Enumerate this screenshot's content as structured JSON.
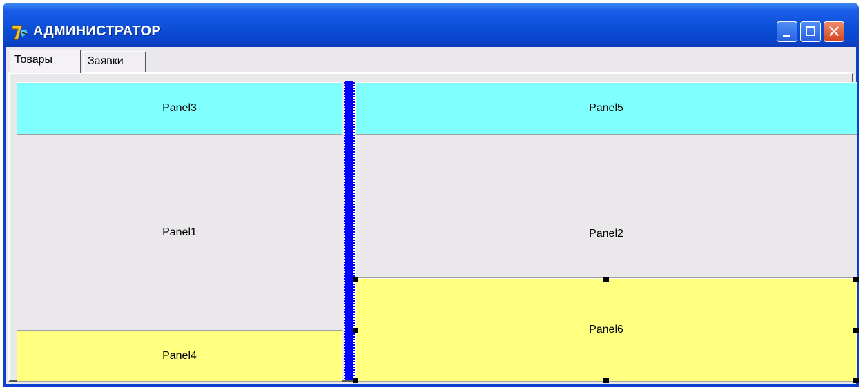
{
  "window": {
    "title": "АДМИНИСТРАТОР",
    "icon": "delphi-7-icon",
    "controls": {
      "minimize": "minimize-icon",
      "maximize": "maximize-icon",
      "close": "✕"
    }
  },
  "tabs": [
    {
      "label": "Товары",
      "active": true
    },
    {
      "label": "Заявки",
      "active": false
    }
  ],
  "panels": {
    "panel3": {
      "caption": "Panel3",
      "color": "#80ffff"
    },
    "panel1": {
      "caption": "Panel1",
      "color": "#ebe8ec"
    },
    "panel4": {
      "caption": "Panel4",
      "color": "#ffff80"
    },
    "panel5": {
      "caption": "Panel5",
      "color": "#80ffff"
    },
    "panel2": {
      "caption": "Panel2",
      "color": "#ebe8ec"
    },
    "panel6": {
      "caption": "Panel6",
      "color": "#ffff80"
    }
  },
  "colors": {
    "splitter": "#0000ff",
    "titlebar": "#0c4fd8"
  }
}
